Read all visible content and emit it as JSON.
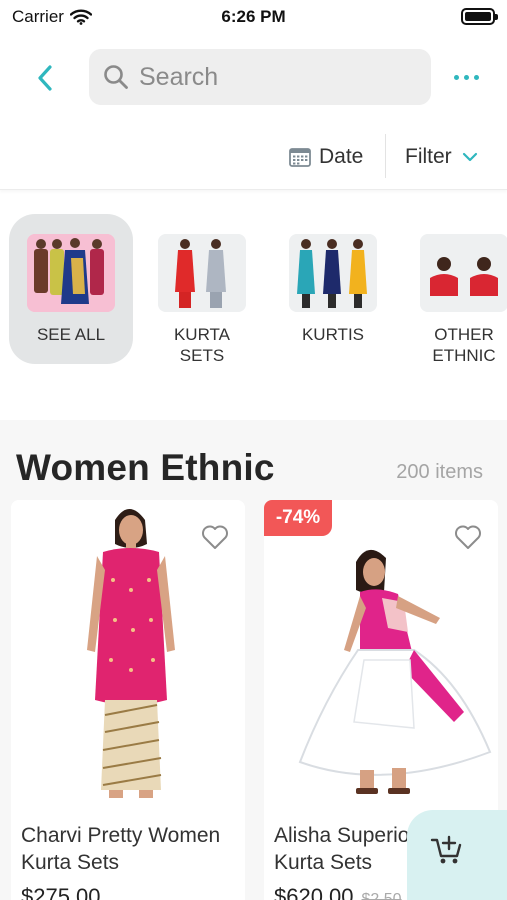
{
  "status_bar": {
    "carrier": "Carrier",
    "time": "6:26 PM"
  },
  "nav": {
    "search_placeholder": "Search"
  },
  "sort_bar": {
    "date_label": "Date",
    "filter_label": "Filter"
  },
  "categories": [
    {
      "label": "SEE ALL",
      "selected": true
    },
    {
      "label": "KURTA SETS",
      "selected": false
    },
    {
      "label": "KURTIS",
      "selected": false
    },
    {
      "label": "OTHER ETHNIC",
      "selected": false
    }
  ],
  "section": {
    "title": "Women Ethnic",
    "count": "200 items"
  },
  "products": [
    {
      "name": "Charvi Pretty Women Kurta Sets",
      "price": "$275.00",
      "mrp": "",
      "discount": ""
    },
    {
      "name": "Alisha Superior Women Kurta Sets",
      "price": "$620.00",
      "mrp": "$2,50",
      "discount": "-74%"
    }
  ],
  "colors": {
    "accent": "#2fb7be",
    "discount_badge": "#f25757",
    "cart_button_bg": "#d8f1f1"
  },
  "icons": [
    "back-chevron-icon",
    "search-icon",
    "more-dots-icon",
    "calendar-icon",
    "chevron-down-icon",
    "heart-outline-icon",
    "add-to-cart-icon"
  ]
}
